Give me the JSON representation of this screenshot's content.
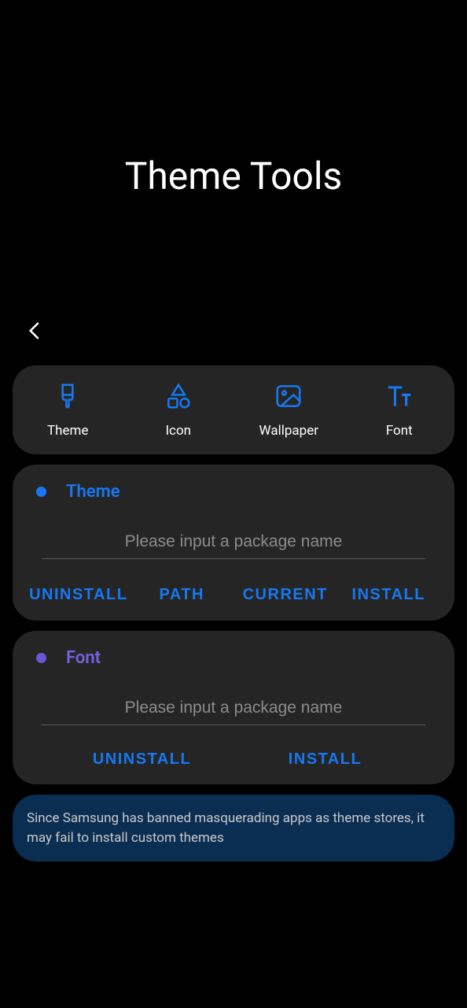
{
  "page_title": "Theme Tools",
  "categories": [
    {
      "label": "Theme"
    },
    {
      "label": "Icon"
    },
    {
      "label": "Wallpaper"
    },
    {
      "label": "Font"
    }
  ],
  "theme_section": {
    "title": "Theme",
    "input_placeholder": "Please input a package name",
    "buttons": {
      "uninstall": "UNINSTALL",
      "path": "PATH",
      "current": "CURRENT",
      "install": "INSTALL"
    }
  },
  "font_section": {
    "title": "Font",
    "input_placeholder": "Please input a package name",
    "buttons": {
      "uninstall": "UNINSTALL",
      "install": "INSTALL"
    }
  },
  "info_message": "Since Samsung has banned masquerading apps as theme stores, it may fail to install custom themes"
}
